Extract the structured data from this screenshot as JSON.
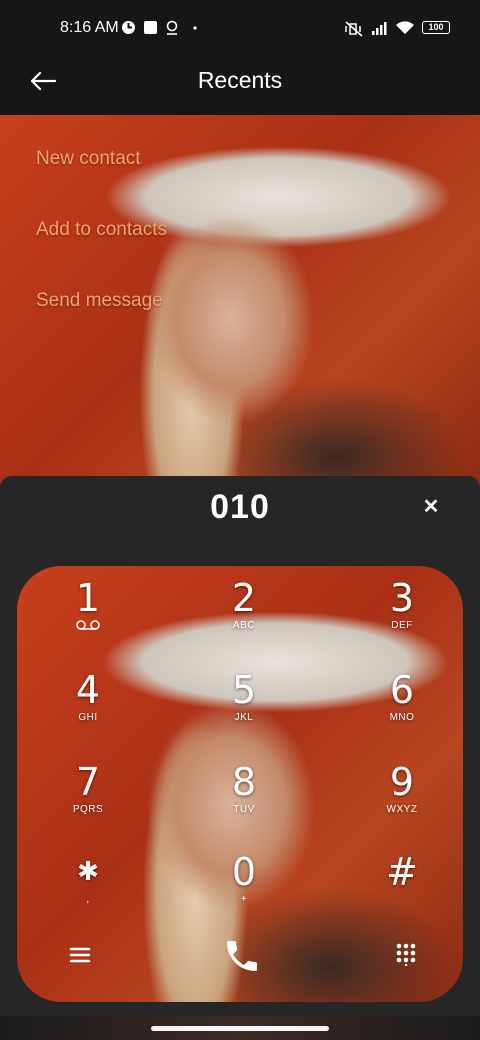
{
  "status_bar": {
    "time": "8:16 AM",
    "battery": "100",
    "left_icons": [
      "cloud-sync-icon",
      "notification-square-icon",
      "location-icon",
      "dot-icon"
    ],
    "right_icons": [
      "mute-vibrate-icon",
      "signal-icon",
      "wifi-icon",
      "battery-icon"
    ]
  },
  "app_bar": {
    "title": "Recents",
    "back_icon": "back-arrow-icon"
  },
  "actions": [
    {
      "label": "New contact"
    },
    {
      "label": "Add to contacts"
    },
    {
      "label": "Send message"
    }
  ],
  "dialer": {
    "number": "010",
    "clear_icon": "close-icon",
    "keys": [
      {
        "digit": "1",
        "letters": ""
      },
      {
        "digit": "2",
        "letters": "ABC"
      },
      {
        "digit": "3",
        "letters": "DEF"
      },
      {
        "digit": "4",
        "letters": "GHI"
      },
      {
        "digit": "5",
        "letters": "JKL"
      },
      {
        "digit": "6",
        "letters": "MNO"
      },
      {
        "digit": "7",
        "letters": "PQRS"
      },
      {
        "digit": "8",
        "letters": "TUV"
      },
      {
        "digit": "9",
        "letters": "WXYZ"
      },
      {
        "digit": "✱",
        "letters": ","
      },
      {
        "digit": "0",
        "letters": "+"
      },
      {
        "digit": "#",
        "letters": ""
      }
    ],
    "key1_sub_icon": "voicemail-icon",
    "bottom_icons": [
      "menu-icon",
      "call-icon",
      "dialpad-icon"
    ]
  },
  "colors": {
    "accent": "#f2a36b",
    "background": "#161616",
    "sheet": "#262626"
  }
}
